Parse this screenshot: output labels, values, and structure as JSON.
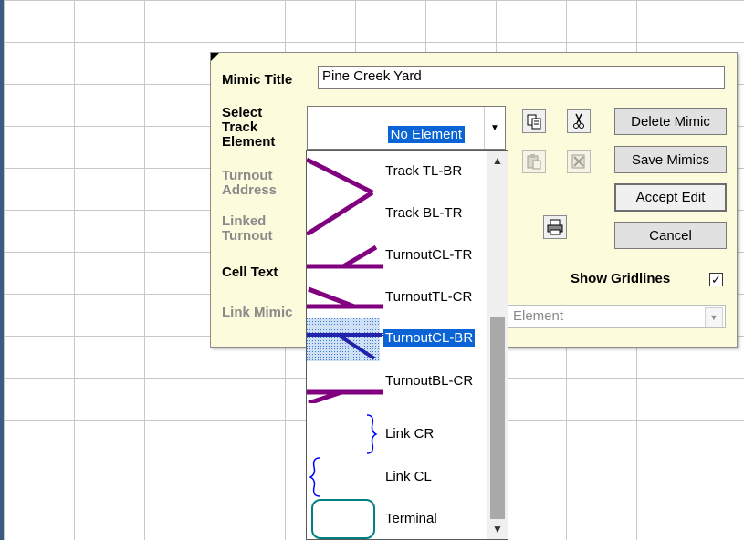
{
  "panel": {
    "mimic_title_label": "Mimic Title",
    "mimic_title_value": "Pine Creek Yard",
    "select_element_label_1": "Select",
    "select_element_label_2": "Track",
    "select_element_label_3": "Element",
    "selected_element": "No Element",
    "turnout_address_label_1": "Turnout",
    "turnout_address_label_2": "Address",
    "linked_turnout_label_1": "Linked",
    "linked_turnout_label_2": "Turnout",
    "cell_text_label": "Cell Text",
    "link_mimic_label": "Link Mimic",
    "link_mimic_value": "Element",
    "show_gridlines_label": "Show Gridlines",
    "show_gridlines_checked": "✓",
    "buttons": {
      "delete": "Delete Mimic",
      "save": "Save Mimics",
      "accept": "Accept Edit",
      "cancel": "Cancel"
    }
  },
  "dropdown": {
    "items": [
      {
        "label": "Track TL-BR",
        "icon": "track-tl-br-icon",
        "color": "#800080"
      },
      {
        "label": "Track BL-TR",
        "icon": "track-bl-tr-icon",
        "color": "#800080"
      },
      {
        "label": "TurnoutCL-TR",
        "icon": "turnout-cl-tr-icon",
        "color": "#800080"
      },
      {
        "label": "TurnoutTL-CR",
        "icon": "turnout-tl-cr-icon",
        "color": "#800080"
      },
      {
        "label": "TurnoutCL-BR",
        "icon": "turnout-cl-br-icon",
        "color": "#2222aa",
        "selected": true
      },
      {
        "label": "TurnoutBL-CR",
        "icon": "turnout-bl-cr-icon",
        "color": "#800080"
      },
      {
        "label": "Link CR",
        "icon": "link-cr-icon",
        "color": "#0000ff"
      },
      {
        "label": "Link CL",
        "icon": "link-cl-icon",
        "color": "#0000ff"
      },
      {
        "label": "Terminal",
        "icon": "terminal-icon",
        "color": "#008080"
      }
    ]
  },
  "icons": {
    "copy": "copy-icon",
    "cut": "scissors-icon",
    "paste": "paste-icon",
    "delete": "delete-cell-icon",
    "print": "printer-icon"
  }
}
